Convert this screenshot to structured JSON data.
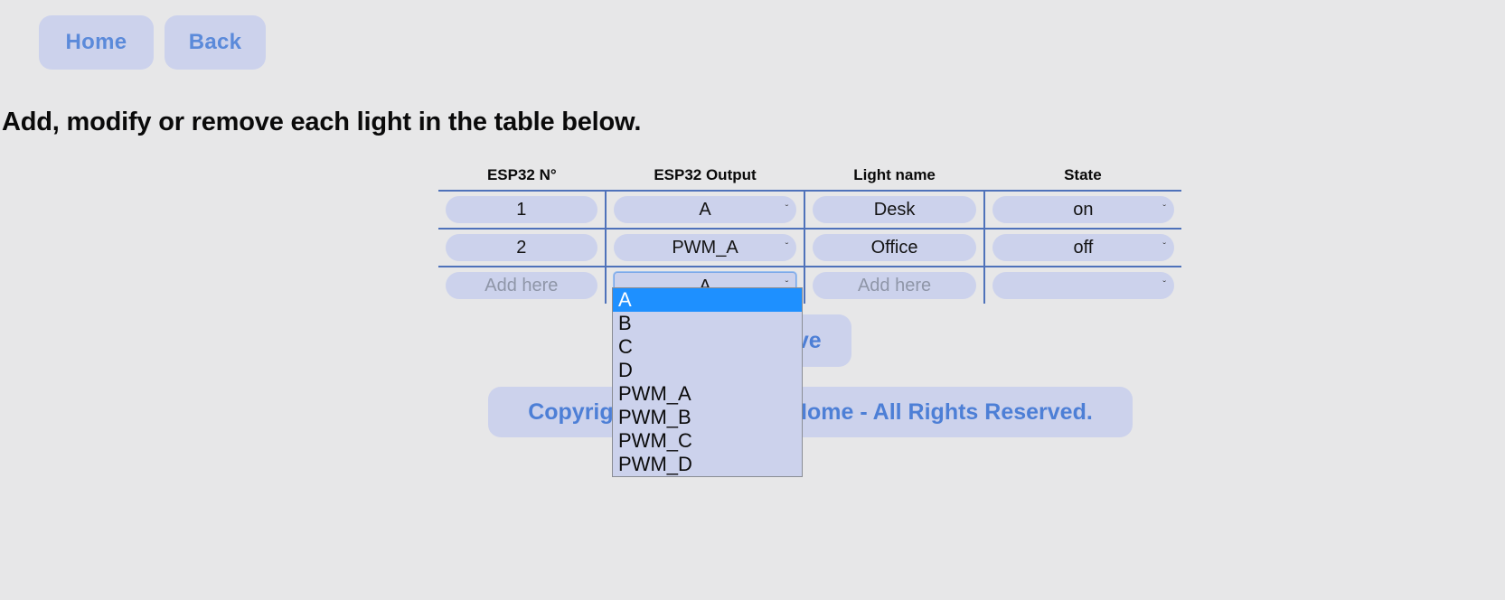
{
  "nav": {
    "home_label": "Home",
    "back_label": "Back"
  },
  "instruction": "Add, modify or remove each light in the table below.",
  "table": {
    "headers": [
      "ESP32 N°",
      "ESP32 Output",
      "Light name",
      "State"
    ],
    "rows": [
      {
        "esp32_no": "1",
        "output": "A",
        "light_name": "Desk",
        "state": "on"
      },
      {
        "esp32_no": "2",
        "output": "PWM_A",
        "light_name": "Office",
        "state": "off"
      },
      {
        "esp32_no_placeholder": "Add here",
        "output": "A",
        "light_name_placeholder": "Add here",
        "state": ""
      }
    ],
    "output_options": [
      "A",
      "B",
      "C",
      "D",
      "PWM_A",
      "PWM_B",
      "PWM_C",
      "PWM_D"
    ],
    "state_options": [
      "on",
      "off"
    ]
  },
  "dropdown": {
    "open": true,
    "selected": "A",
    "options": [
      "A",
      "B",
      "C",
      "D",
      "PWM_A",
      "PWM_B",
      "PWM_C",
      "PWM_D"
    ]
  },
  "save_label": "Save",
  "footer": "Copyright © 2023 Smart Home - All Rights Reserved.",
  "icons": {
    "chevron_down": "ˇ"
  },
  "colors": {
    "page_background": "#e7e7e8",
    "pill": "#ccd2ec",
    "accent_blue": "#4d7fd6",
    "table_border": "#4f72ba",
    "highlight": "#1e90ff",
    "placeholder": "#8f96a8"
  }
}
